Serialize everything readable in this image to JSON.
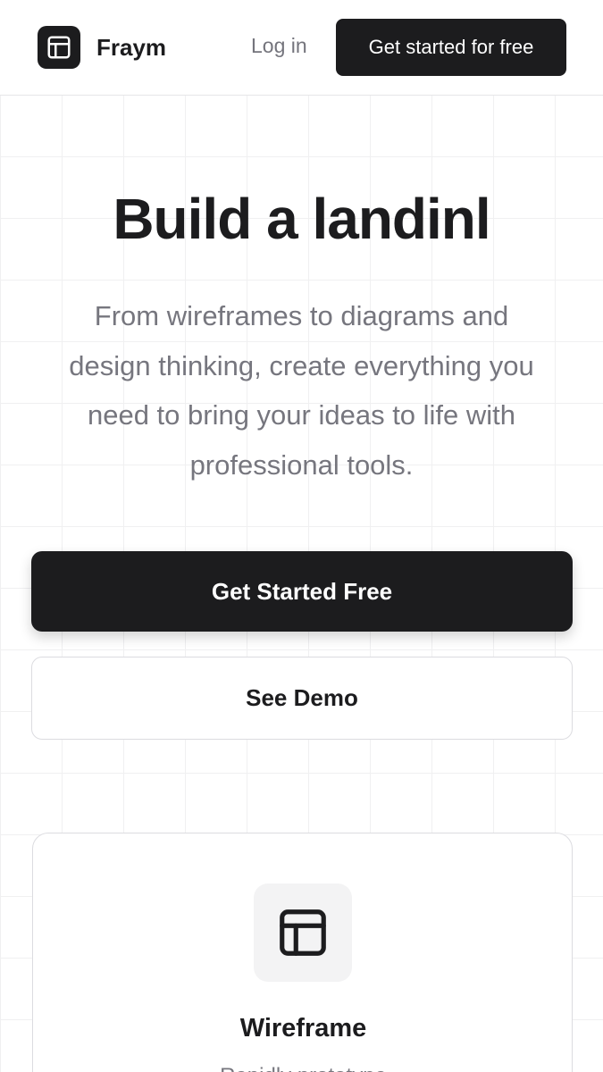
{
  "header": {
    "brand_name": "Fraym",
    "login_label": "Log in",
    "cta_label": "Get started for free"
  },
  "hero": {
    "title": "Build a landinl",
    "subtitle_lines": [
      "From wireframes to diagrams and",
      "design thinking, create everything you",
      "need to bring your ideas to life with",
      "professional tools."
    ],
    "primary_cta_label": "Get Started Free",
    "secondary_cta_label": "See Demo"
  },
  "feature_card": {
    "icon": "layout-icon",
    "title": "Wireframe",
    "description": "Rapidly prototype"
  },
  "colors": {
    "primary": "#1c1c1e",
    "muted_text": "#76767e",
    "border": "#dcdce0",
    "grid_line": "#f0f0f1"
  }
}
